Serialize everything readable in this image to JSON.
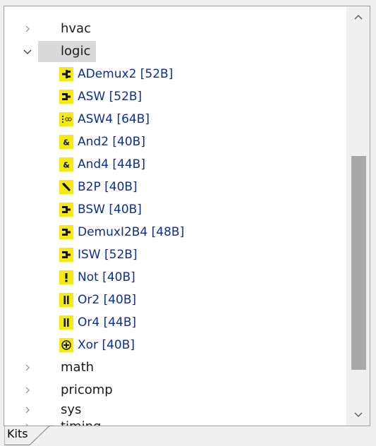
{
  "tree": {
    "categories_top": [
      {
        "label": "hvac",
        "expanded": false
      }
    ],
    "selected_category": {
      "label": "logic",
      "expanded": true
    },
    "items": [
      {
        "label": "ADemux2 [52B]",
        "icon": "demux-icon"
      },
      {
        "label": "ASW [52B]",
        "icon": "switch-icon"
      },
      {
        "label": "ASW4 [64B]",
        "icon": "switch4-icon"
      },
      {
        "label": "And2 [40B]",
        "icon": "ampersand-icon"
      },
      {
        "label": "And4 [44B]",
        "icon": "ampersand-icon"
      },
      {
        "label": "B2P [40B]",
        "icon": "b2p-icon"
      },
      {
        "label": "BSW [40B]",
        "icon": "switch-icon"
      },
      {
        "label": "DemuxI2B4 [48B]",
        "icon": "switch-icon"
      },
      {
        "label": "ISW [52B]",
        "icon": "switch-icon"
      },
      {
        "label": "Not [40B]",
        "icon": "exclamation-icon"
      },
      {
        "label": "Or2 [40B]",
        "icon": "or-icon"
      },
      {
        "label": "Or4 [44B]",
        "icon": "or-icon"
      },
      {
        "label": "Xor [40B]",
        "icon": "xor-icon"
      }
    ],
    "categories_bottom": [
      {
        "label": "math",
        "expanded": false
      },
      {
        "label": "pricomp",
        "expanded": false
      },
      {
        "label": "sys",
        "expanded": false
      },
      {
        "label": "timing",
        "expanded": false
      }
    ]
  },
  "tabs": {
    "active_label": "Kits"
  },
  "colors": {
    "icon_yellow": "#f5ea14",
    "item_text": "#0c2f8a",
    "selection_bg": "#d9d9d9",
    "scroll_thumb": "#a8a8a8"
  }
}
